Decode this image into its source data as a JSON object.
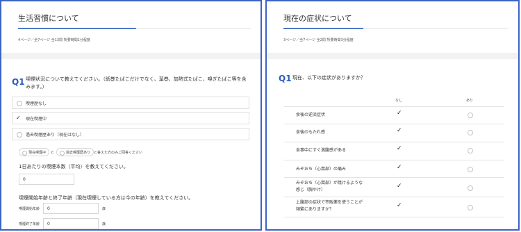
{
  "left": {
    "title": "生活習慣について",
    "meta": "4ページ／全7ページ 全13問 所要時間1分程度",
    "q1_number": "Q1",
    "q1_text": "喫煙状況について教えてください。（紙巻たばこだけでなく、葉巻、加熱式たばこ、嗅ぎたばこ等を含みます。）",
    "options": [
      {
        "label": "喫煙歴なし",
        "checked": false
      },
      {
        "label": "現在喫煙中",
        "checked": true
      },
      {
        "label": "過去喫煙歴あり（現在はなし）",
        "checked": false
      }
    ],
    "hint": {
      "chip1": "現在喫煙中",
      "and": "と",
      "chip2": "過去喫煙歴あり",
      "tail": "と答えた方のみご回答ください"
    },
    "daily_label": "1日あたりの喫煙本数（平均）を教えてください。",
    "daily_value": "0",
    "age_label": "喫煙開始年齢と終了年齢（現在喫煙している方は今の年齢）を教えてください。",
    "start_label": "喫煙開始年齢",
    "start_value": "0",
    "start_unit": "歳",
    "end_label": "喫煙終了年齢",
    "end_value": "0",
    "end_unit": "歳"
  },
  "right": {
    "title": "現在の症状について",
    "meta": "3ページ／全7ページ 全2問 所要時間3分程度",
    "q1_number": "Q1",
    "q1_text": "現在、以下の症状がありますか？",
    "col_none": "なし",
    "col_yes": "あり",
    "rows": [
      {
        "label": "食後の逆流症状",
        "answer": "none"
      },
      {
        "label": "食後のもたれ感",
        "answer": "none"
      },
      {
        "label": "食事中にすぐ満腹感がある",
        "answer": "none"
      },
      {
        "label": "みぞおち（心窩部）の痛み",
        "answer": "none"
      },
      {
        "label": "みぞおち（心窩部）が焼けるような感じ（胸やけ）",
        "answer": "none"
      },
      {
        "label": "上腹部の症状で市販薬を使うことが頻繁にありますか？",
        "answer": "none"
      }
    ]
  }
}
